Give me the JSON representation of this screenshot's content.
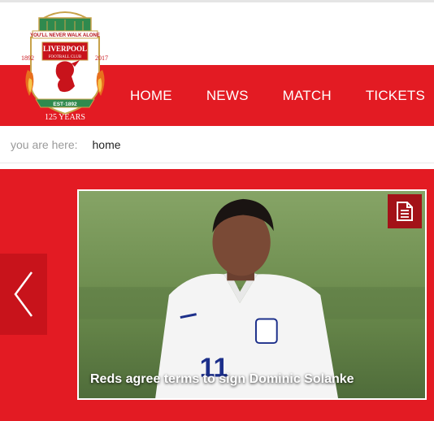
{
  "header": {
    "crest": {
      "motto": "YOU'LL NEVER WALK ALONE",
      "name_line1": "LIVERPOOL",
      "name_line2": "FOOTBALL CLUB",
      "year_left": "1892",
      "year_right": "2017",
      "established": "EST·1892",
      "anniversary": "125 YEARS"
    },
    "nav": [
      {
        "label": "HOME"
      },
      {
        "label": "NEWS"
      },
      {
        "label": "MATCH"
      },
      {
        "label": "TICKETS"
      }
    ],
    "accent_color": "#e31b23"
  },
  "breadcrumb": {
    "label": "you are here:",
    "current": "home"
  },
  "hero": {
    "slide_title": "Reds agree terms to sign Dominic Solanke",
    "prev_icon": "chevron-left-icon",
    "badge_icon": "document-icon"
  }
}
